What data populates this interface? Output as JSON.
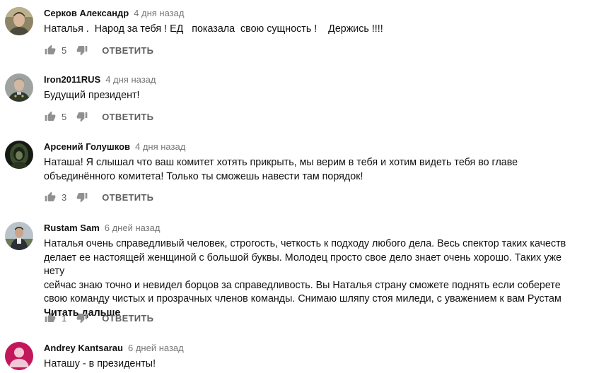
{
  "comments": [
    {
      "author": "Серков Александр",
      "time": "4 дня назад",
      "text": "Наталья .  Народ за тебя ! ЕД   показала  свою сущность !    Держись !!!!",
      "likes": "5",
      "reply": "ОТВЕТИТЬ",
      "avatar": "avatar-photo-man"
    },
    {
      "author": "Iron2011RUS",
      "time": "4 дня назад",
      "text": "Будущий президент!",
      "likes": "5",
      "reply": "ОТВЕТИТЬ",
      "avatar": "avatar-photo-uniform"
    },
    {
      "author": "Арсений Голушков",
      "time": "4 дня назад",
      "text": "Наташа! Я слышал что ваш комитет хотять прикрыть, мы верим в тебя и хотим видеть тебя во главе\nобъединённого комитета! Только ты сможешь навести там порядок!",
      "likes": "3",
      "reply": "ОТВЕТИТЬ",
      "avatar": "avatar-photo-dark"
    },
    {
      "author": "Rustam Sam",
      "time": "6 дней назад",
      "text": "Наталья очень справедливый человек, строгость, четкость к подходу любого дела. Весь спектор таких качеств\nделает ее настоящей женщиной с большой буквы. Молодец просто свое дело знает очень хорошо. Таких уже нету\nсейчас знаю точно и невидел борцов за справедливость. Вы Наталья страну сможете поднять если соберете\nсвою команду чистых и прозрачных членов команды. Снимаю шляпу стоя миледи, с уважением к вам Рустам",
      "read_more": "Читать дальше",
      "likes": "1",
      "reply": "ОТВЕТИТЬ",
      "avatar": "avatar-photo-outdoor"
    },
    {
      "author": "Andrey Kantsarau",
      "time": "6 дней назад",
      "text": "Наташу - в президенты!",
      "avatar": "avatar-default-pink",
      "avatar_color": "#c2185b"
    }
  ],
  "colors": {
    "text": "#111111",
    "secondary": "#606060",
    "time": "#767676"
  },
  "icons": {
    "like": "thumb-up-icon",
    "dislike": "thumb-down-icon"
  }
}
